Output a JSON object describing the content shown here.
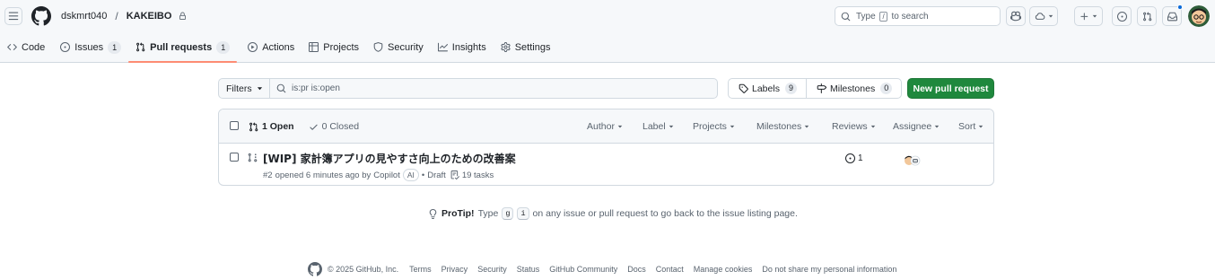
{
  "header": {
    "owner": "dskmrt040",
    "separator": "/",
    "repo": "KAKEIBO",
    "search": {
      "prefix": "Type",
      "key": "/",
      "suffix": "to search"
    }
  },
  "repo_nav": [
    {
      "label": "Code",
      "icon": "code-icon"
    },
    {
      "label": "Issues",
      "count": "1",
      "icon": "issue-opened-icon"
    },
    {
      "label": "Pull requests",
      "count": "1",
      "icon": "git-pull-request-icon",
      "selected": true
    },
    {
      "label": "Actions",
      "icon": "play-icon"
    },
    {
      "label": "Projects",
      "icon": "table-icon"
    },
    {
      "label": "Security",
      "icon": "shield-icon"
    },
    {
      "label": "Insights",
      "icon": "graph-icon"
    },
    {
      "label": "Settings",
      "icon": "gear-icon"
    }
  ],
  "subnav": {
    "filters_label": "Filters",
    "query": "is:pr is:open",
    "labels_label": "Labels",
    "labels_count": "9",
    "milestones_label": "Milestones",
    "milestones_count": "0",
    "new_pr_label": "New pull request"
  },
  "list_header": {
    "open_label": "1 Open",
    "closed_label": "0 Closed",
    "filters": [
      "Author",
      "Label",
      "Projects",
      "Milestones",
      "Reviews",
      "Assignee",
      "Sort"
    ]
  },
  "pull_requests": [
    {
      "title": "[WIP] 家計簿アプリの見やすさ向上のための改善案",
      "number": "#2",
      "opened_text": "opened 6 minutes ago by",
      "author": "Copilot",
      "author_badge": "AI",
      "status": "Draft",
      "tasks": "19 tasks",
      "review_count": "1"
    }
  ],
  "protip": {
    "label": "ProTip!",
    "before": "Type",
    "key1": "g",
    "key2": "i",
    "after": "on any issue or pull request to go back to the issue listing page."
  },
  "footer": {
    "copyright": "© 2025 GitHub, Inc.",
    "links": [
      "Terms",
      "Privacy",
      "Security",
      "Status",
      "GitHub Community",
      "Docs",
      "Contact",
      "Manage cookies",
      "Do not share my personal information"
    ]
  },
  "colors": {
    "accent_green": "#1f883d",
    "selected_underline": "#fd8c73",
    "header_bg": "#f6f8fa",
    "border": "#d1d9e0",
    "notification": "#0969da"
  }
}
